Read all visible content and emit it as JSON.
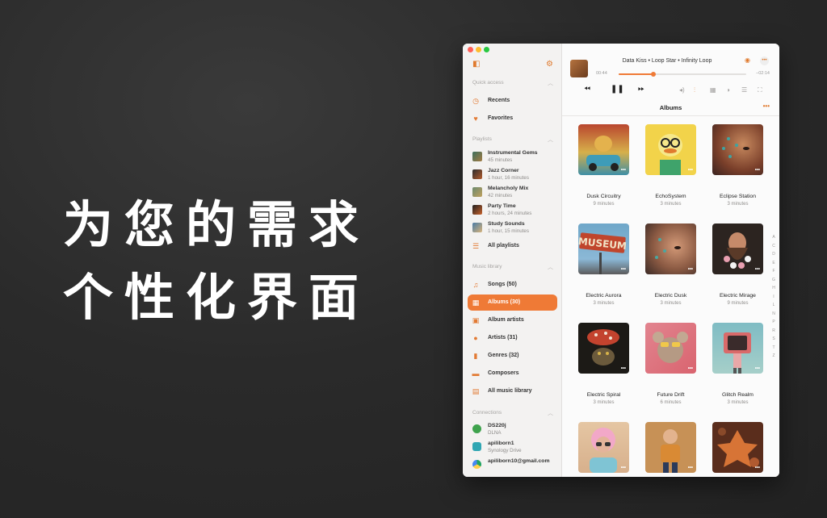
{
  "promo": {
    "line1": "为您的需求",
    "line2": "个性化界面"
  },
  "sidebar": {
    "quick_access": {
      "title": "Quick access",
      "items": [
        {
          "label": "Recents"
        },
        {
          "label": "Favorites"
        }
      ]
    },
    "playlists": {
      "title": "Playlists",
      "items": [
        {
          "title": "Instrumental Gems",
          "sub": "45 minutes"
        },
        {
          "title": "Jazz Corner",
          "sub": "1 hour, 16 minutes"
        },
        {
          "title": "Melancholy Mix",
          "sub": "42 minutes"
        },
        {
          "title": "Party Time",
          "sub": "2 hours, 24 minutes"
        },
        {
          "title": "Study Sounds",
          "sub": "1 hour, 15 minutes"
        }
      ],
      "all_label": "All playlists"
    },
    "music_library": {
      "title": "Music library",
      "items": [
        {
          "label": "Songs (50)"
        },
        {
          "label": "Albums (30)"
        },
        {
          "label": "Album artists"
        },
        {
          "label": "Artists (31)"
        },
        {
          "label": "Genres (32)"
        },
        {
          "label": "Composers"
        },
        {
          "label": "All music library"
        }
      ]
    },
    "connections": {
      "title": "Connections",
      "items": [
        {
          "title": "DS220j",
          "sub": "DLNA"
        },
        {
          "title": "apiliborn1",
          "sub": "Synology Drive"
        },
        {
          "title": "apiliborn10@gmail.com",
          "sub": ""
        }
      ]
    }
  },
  "player": {
    "now_playing": "Data Kiss • Loop Star • Infinity Loop",
    "elapsed": "00:44",
    "remaining": "−02:14",
    "progress": 0.27
  },
  "albums": {
    "title": "Albums",
    "items": [
      {
        "name": "Dusk Circuitry",
        "duration": "9 minutes"
      },
      {
        "name": "EchoSystem",
        "duration": "3 minutes"
      },
      {
        "name": "Eclipse Station",
        "duration": "3 minutes"
      },
      {
        "name": "Electric Aurora",
        "duration": "3 minutes"
      },
      {
        "name": "Electric Dusk",
        "duration": "3 minutes"
      },
      {
        "name": "Electric Mirage",
        "duration": "9 minutes"
      },
      {
        "name": "Electric Spiral",
        "duration": "3 minutes"
      },
      {
        "name": "Future Drift",
        "duration": "6 minutes"
      },
      {
        "name": "Glitch Realm",
        "duration": "3 minutes"
      },
      {
        "name": "",
        "duration": ""
      },
      {
        "name": "",
        "duration": ""
      },
      {
        "name": "",
        "duration": ""
      }
    ],
    "cover_text": "MUSEUM",
    "more": "•••"
  },
  "alpha_index": [
    "A",
    "C",
    "D",
    "E",
    "F",
    "G",
    "H",
    "I",
    "L",
    "N",
    "P",
    "R",
    "S",
    "T",
    "Z"
  ],
  "colors": {
    "accent": "#ef7a36"
  }
}
